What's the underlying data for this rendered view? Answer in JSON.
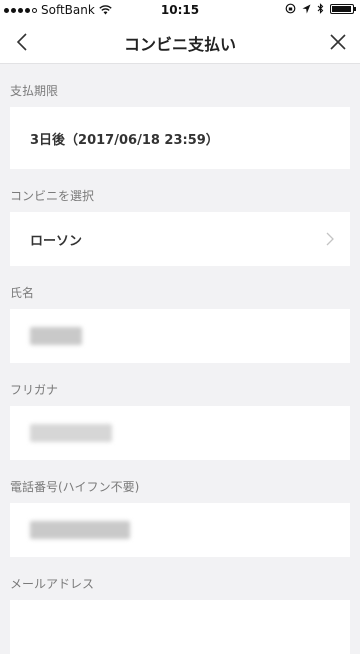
{
  "status_bar": {
    "carrier": "SoftBank",
    "time": "10:15"
  },
  "nav": {
    "title": "コンビニ支払い"
  },
  "sections": {
    "deadline": {
      "label": "支払期限",
      "value": "3日後（2017/06/18 23:59）"
    },
    "store": {
      "label": "コンビニを選択",
      "value": "ローソン"
    },
    "name": {
      "label": "氏名",
      "value": ""
    },
    "furigana": {
      "label": "フリガナ",
      "value": ""
    },
    "phone": {
      "label": "電話番号(ハイフン不要)",
      "value": ""
    },
    "email": {
      "label": "メールアドレス"
    }
  },
  "icons": {
    "back": "chevron-left-icon",
    "close": "close-icon",
    "store_select": "chevron-right-icon"
  }
}
